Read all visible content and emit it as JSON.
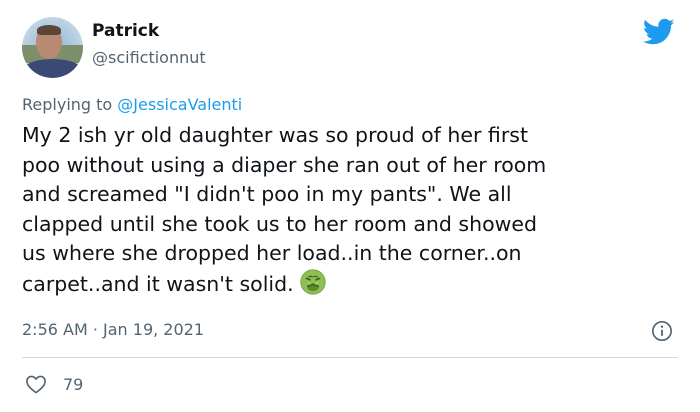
{
  "author": {
    "name": "Patrick",
    "handle": "@scifictionnut"
  },
  "reply": {
    "prefix": "Replying to ",
    "mention": "@JessicaValenti"
  },
  "tweet": {
    "lines": [
      "My 2 ish yr old daughter was so proud of her first",
      "poo without using a diaper she ran out of her room",
      "and screamed \"I didn't poo in my pants\". We all",
      "clapped until she took us to her room and showed",
      "us where she dropped her load..in the corner..on",
      "carpet..and it wasn't solid."
    ],
    "emoji": "nauseated-face"
  },
  "meta": {
    "timestamp": "2:56 AM · Jan 19, 2021"
  },
  "stats": {
    "likes": "79"
  },
  "colors": {
    "accent": "#1d9bf0",
    "secondary_text": "#536471",
    "primary_text": "#0f1419",
    "divider": "#cfd9de"
  },
  "icons": [
    "twitter-bird-icon",
    "info-icon",
    "heart-icon",
    "nauseated-face-emoji"
  ]
}
